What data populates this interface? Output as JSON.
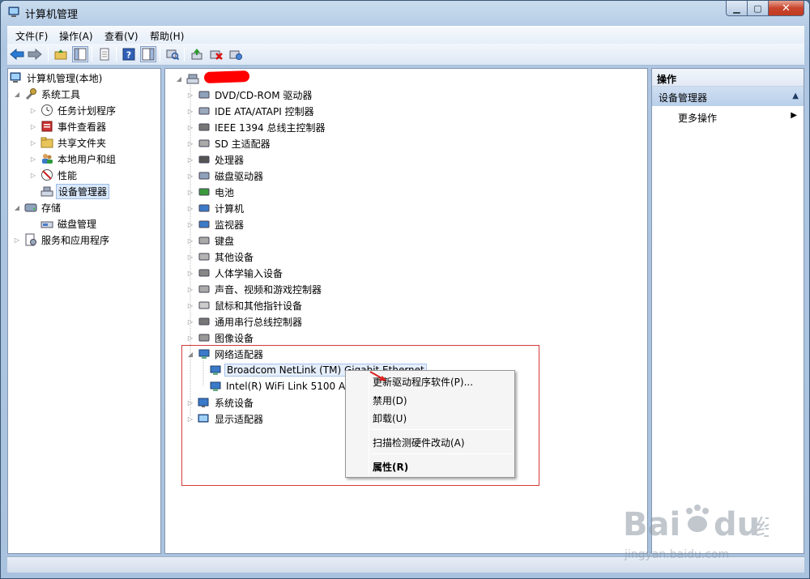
{
  "window": {
    "title": "计算机管理"
  },
  "menubar": {
    "items": [
      "文件(F)",
      "操作(A)",
      "查看(V)",
      "帮助(H)"
    ]
  },
  "left_tree": {
    "root": "计算机管理(本地)",
    "system_tools": "系统工具",
    "task_scheduler": "任务计划程序",
    "event_viewer": "事件查看器",
    "shared_folders": "共享文件夹",
    "local_users": "本地用户和组",
    "performance": "性能",
    "device_manager": "设备管理器",
    "storage": "存储",
    "disk_management": "磁盘管理",
    "services_apps": "服务和应用程序"
  },
  "device_tree": {
    "categories": [
      "DVD/CD-ROM 驱动器",
      "IDE ATA/ATAPI 控制器",
      "IEEE 1394 总线主控制器",
      "SD 主适配器",
      "处理器",
      "磁盘驱动器",
      "电池",
      "计算机",
      "监视器",
      "键盘",
      "其他设备",
      "人体学输入设备",
      "声音、视频和游戏控制器",
      "鼠标和其他指针设备",
      "通用串行总线控制器",
      "图像设备"
    ],
    "network_adapters": "网络适配器",
    "adapter_1": "Broadcom NetLink (TM) Gigabit Ethernet",
    "adapter_2": "Intel(R) WiFi Link 5100 A",
    "system_devices": "系统设备",
    "display_adapters": "显示适配器"
  },
  "context_menu": {
    "update_driver": "更新驱动程序软件(P)...",
    "disable": "禁用(D)",
    "uninstall": "卸载(U)",
    "scan": "扫描检测硬件改动(A)",
    "properties": "属性(R)"
  },
  "actions_pane": {
    "header": "操作",
    "section": "设备管理器",
    "more": "更多操作"
  },
  "watermark": {
    "brand": "Bai",
    "brand2": "du",
    "chinese": "经验",
    "url": "jingyan.baidu.com"
  },
  "colors": {
    "selection": "#d9e8fb",
    "highlight_box": "#d43a3a",
    "redaction": "#ff0000"
  }
}
